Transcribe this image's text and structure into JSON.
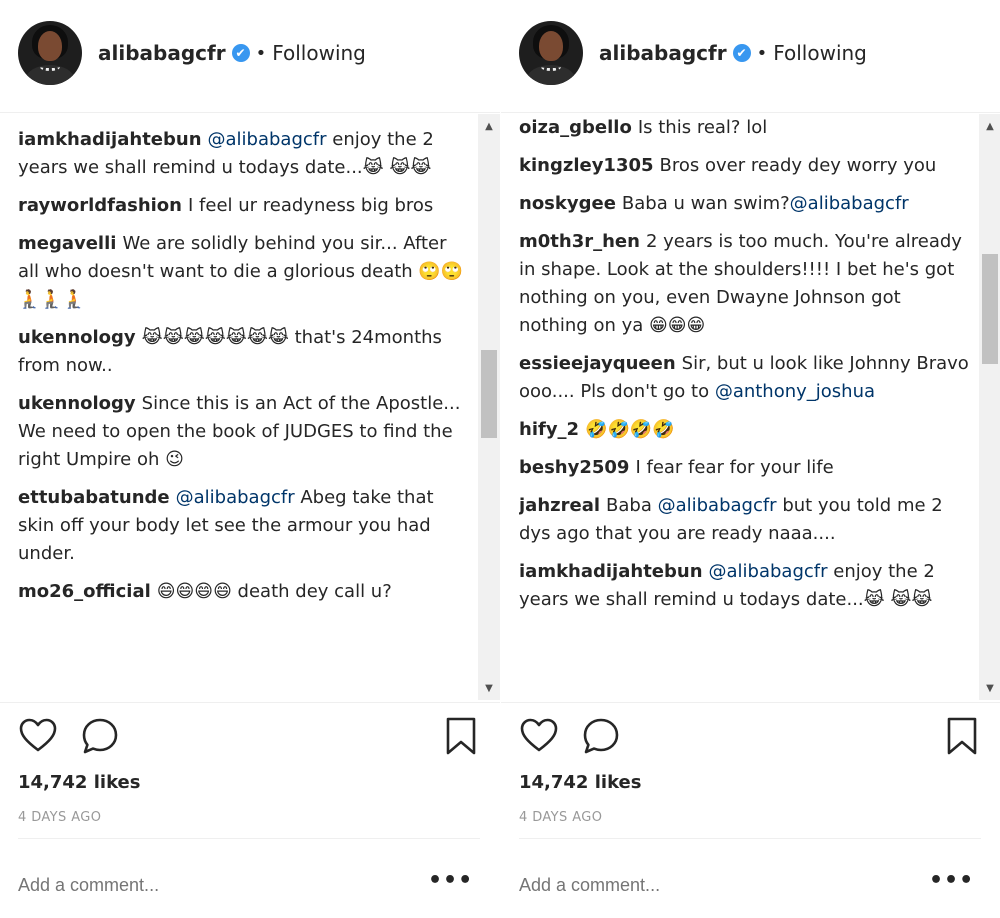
{
  "left": {
    "username": "alibabagcfr",
    "verified": "✔",
    "dot": "•",
    "following": "Following",
    "partial_top": "... ... ... ... ...",
    "comments": [
      {
        "user": "iamkhadijahtebun",
        "mention": "@alibabagcfr",
        "text": " enjoy the 2 years we shall remind u todays date...😹 😹😹"
      },
      {
        "user": "rayworldfashion",
        "text": "I feel ur readyness big bros"
      },
      {
        "user": "megavelli",
        "text": "We are solidly behind you sir... After all who doesn't want to die a glorious death 🙄🙄🧎🧎🧎"
      },
      {
        "user": "ukennology",
        "text": "😹😹😹😹😹😹😹 that's 24months from now.."
      },
      {
        "user": "ukennology",
        "text": "Since this is an Act of the Apostle... We need to open the book of JUDGES to find the right Umpire oh 😉"
      },
      {
        "user": "ettubabatunde",
        "mention": "@alibabagcfr",
        "text": " Abeg take that skin off your body let see the armour you had under."
      },
      {
        "user": "mo26_official",
        "text": "😄😄😄😄 death dey call u?"
      }
    ],
    "likes": "14,742 likes",
    "timestamp": "4 DAYS AGO",
    "add_comment_placeholder": "Add a comment...",
    "more": "•••"
  },
  "right": {
    "username": "alibabagcfr",
    "verified": "✔",
    "dot": "•",
    "following": "Following",
    "comments": [
      {
        "user": "oiza_gbello",
        "text": "Is this real? lol"
      },
      {
        "user": "kingzley1305",
        "text": "Bros over ready dey worry you"
      },
      {
        "user": "noskygee",
        "text": "Baba u wan swim?",
        "mention_after": "@alibabagcfr"
      },
      {
        "user": "m0th3r_hen",
        "text": "2 years is too much. You're already in shape. Look at the shoulders!!!! I bet he's got nothing on you, even Dwayne Johnson got nothing on ya 😁😁😁"
      },
      {
        "user": "essieejayqueen",
        "text": "Sir, but u look like Johnny Bravo ooo.... Pls don't go to ",
        "mention_after": "@anthony_joshua"
      },
      {
        "user": "hify_2",
        "text": "🤣🤣🤣🤣"
      },
      {
        "user": "beshy2509",
        "text": "I fear fear for your life"
      },
      {
        "user": "jahzreal",
        "text": "Baba ",
        "mention_after": "@alibabagcfr",
        "text_after": " but you told me 2 dys ago that you are ready naaa...."
      },
      {
        "user": "iamkhadijahtebun",
        "mention": "@alibabagcfr",
        "text": " enjoy the 2 years we shall remind u todays date...😹 😹😹"
      }
    ],
    "likes": "14,742 likes",
    "timestamp": "4 DAYS AGO",
    "add_comment_placeholder": "Add a comment...",
    "more": "•••"
  },
  "icons": {
    "like": "heart-icon",
    "comment": "speech-bubble-icon",
    "save": "bookmark-icon",
    "scroll_up": "▲",
    "scroll_down": "▼"
  },
  "colors": {
    "mention": "#003569",
    "verified": "#3897f0",
    "muted": "#999999",
    "text": "#262626"
  }
}
